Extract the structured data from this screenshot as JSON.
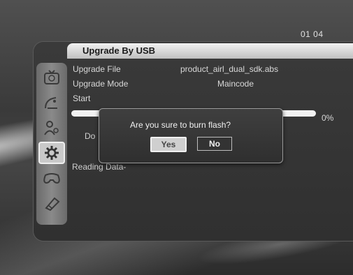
{
  "clock": "01 04",
  "title": "Upgrade By USB",
  "upgrade_file": {
    "label": "Upgrade File",
    "value": "product_airl_dual_sdk.abs"
  },
  "upgrade_mode": {
    "label": "Upgrade Mode",
    "value": "Maincode"
  },
  "start_label": "Start",
  "progress": {
    "percent_text": "0%",
    "value": 0
  },
  "partial_label": "Do",
  "reading_text": "Reading Data-",
  "dialog": {
    "message": "Are you sure to burn flash?",
    "yes_label": "Yes",
    "no_label": "No"
  },
  "sidebar": {
    "icons": [
      "tv-icon",
      "satellite-icon",
      "user-icon",
      "gear-icon",
      "gamepad-icon",
      "usb-icon"
    ],
    "active_index": 3
  }
}
